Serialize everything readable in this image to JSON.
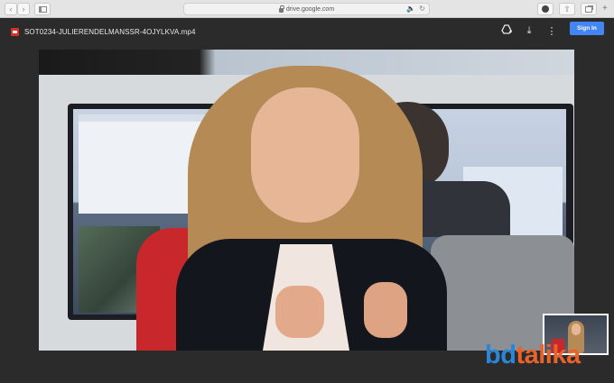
{
  "browser": {
    "back_icon": "chevron-left-icon",
    "forward_icon": "chevron-right-icon",
    "sidebar_icon": "sidebar-icon",
    "address": "drive.google.com",
    "lock_icon": "lock-icon",
    "speaker_icon": "speaker-icon",
    "reload_icon": "reload-icon",
    "download_icon": "download-circle-icon",
    "share_icon": "share-icon",
    "tabs_icon": "tabs-icon",
    "new_tab_icon": "plus-icon"
  },
  "viewer": {
    "file_name": "SOT0234-JULIERENDELMANSSR-4OJYLKVA.mp4",
    "file_icon": "video-file-icon",
    "add_to_drive_icon": "add-to-drive-icon",
    "download_icon": "download-icon",
    "more_icon": "more-vert-icon",
    "sign_in_label": "Sign In"
  },
  "watermark": {
    "part1": "bd",
    "part2": "talika"
  },
  "colors": {
    "accent": "#4285f4",
    "file_icon": "#d93025",
    "watermark_blue": "#2a86d6",
    "watermark_orange": "#e9622b"
  }
}
